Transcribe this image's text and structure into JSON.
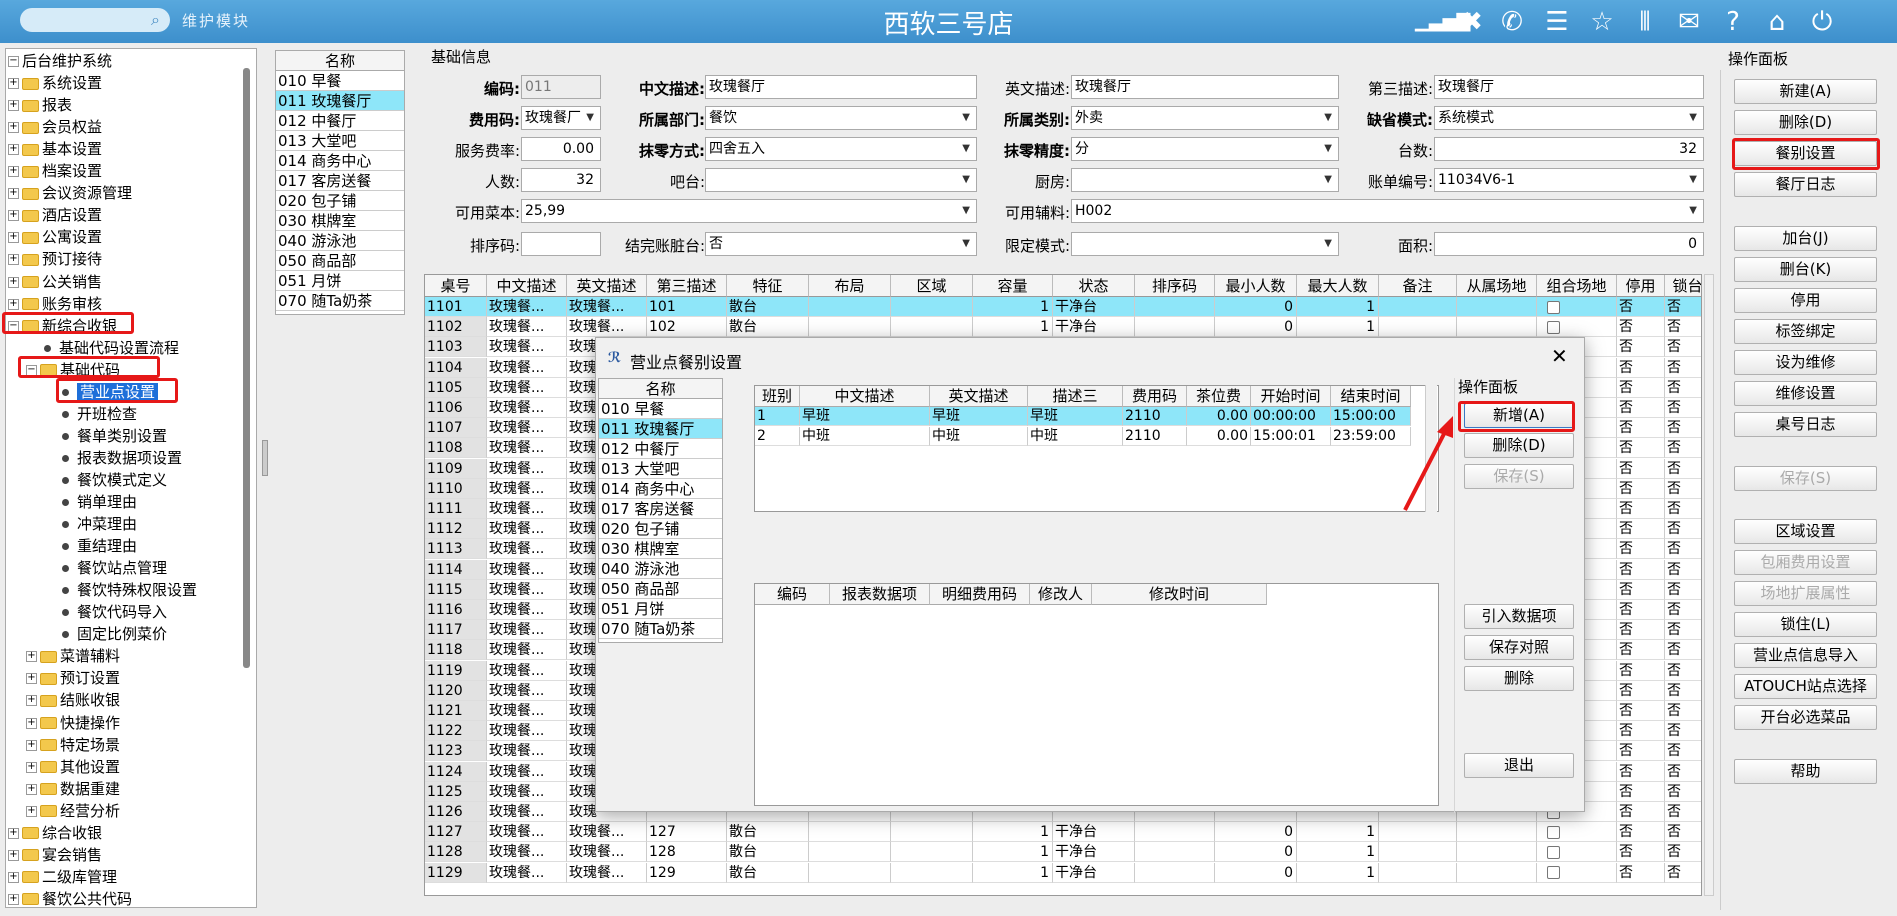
{
  "header": {
    "search_icon": "search-icon",
    "module": "维护模块",
    "title": "西软三号店",
    "icons": [
      "signal-icon",
      "tools-icon",
      "phone-icon",
      "menu-icon",
      "star-icon",
      "columns-icon",
      "mail-icon",
      "help-icon",
      "home-icon",
      "power-icon"
    ]
  },
  "tree": {
    "items": [
      {
        "label": "后台维护系统",
        "type": "root"
      },
      {
        "label": "系统设置",
        "type": "folder"
      },
      {
        "label": "报表",
        "type": "folder"
      },
      {
        "label": "会员权益",
        "type": "folder"
      },
      {
        "label": "基本设置",
        "type": "folder"
      },
      {
        "label": "档案设置",
        "type": "folder"
      },
      {
        "label": "会议资源管理",
        "type": "folder"
      },
      {
        "label": "酒店设置",
        "type": "folder"
      },
      {
        "label": "公寓设置",
        "type": "folder"
      },
      {
        "label": "预订接待",
        "type": "folder"
      },
      {
        "label": "公关销售",
        "type": "folder"
      },
      {
        "label": "账务审核",
        "type": "folder"
      },
      {
        "label": "新综合收银",
        "type": "folder-open"
      },
      {
        "label": "基础代码设置流程",
        "type": "leaf2"
      },
      {
        "label": "基础代码",
        "type": "folder-open2"
      },
      {
        "label": "营业点设置",
        "type": "leaf3-selected"
      },
      {
        "label": "开班检查",
        "type": "leaf3"
      },
      {
        "label": "餐单类别设置",
        "type": "leaf3"
      },
      {
        "label": "报表数据项设置",
        "type": "leaf3"
      },
      {
        "label": "餐饮模式定义",
        "type": "leaf3"
      },
      {
        "label": "销单理由",
        "type": "leaf3"
      },
      {
        "label": "冲菜理由",
        "type": "leaf3"
      },
      {
        "label": "重结理由",
        "type": "leaf3"
      },
      {
        "label": "餐饮站点管理",
        "type": "leaf3"
      },
      {
        "label": "餐饮特殊权限设置",
        "type": "leaf3"
      },
      {
        "label": "餐饮代码导入",
        "type": "leaf3"
      },
      {
        "label": "固定比例菜价",
        "type": "leaf3"
      },
      {
        "label": "菜谱辅料",
        "type": "folder2"
      },
      {
        "label": "预订设置",
        "type": "folder2"
      },
      {
        "label": "结账收银",
        "type": "folder2"
      },
      {
        "label": "快捷操作",
        "type": "folder2"
      },
      {
        "label": "特定场景",
        "type": "folder2"
      },
      {
        "label": "其他设置",
        "type": "folder2"
      },
      {
        "label": "数据重建",
        "type": "folder2"
      },
      {
        "label": "经营分析",
        "type": "folder2"
      },
      {
        "label": "综合收银",
        "type": "folder"
      },
      {
        "label": "宴会销售",
        "type": "folder"
      },
      {
        "label": "二级库管理",
        "type": "folder"
      },
      {
        "label": "餐饮公共代码",
        "type": "folder"
      }
    ]
  },
  "outlets": {
    "header": "名称",
    "rows": [
      "010 早餐",
      "011 玫瑰餐厅",
      "012 中餐厅",
      "013 大堂吧",
      "014 商务中心",
      "017 客房送餐",
      "020 包子铺",
      "030 棋牌室",
      "040 游泳池",
      "050 商品部",
      "051 月饼",
      "070 随Ta奶茶"
    ],
    "selected": 1
  },
  "basic": {
    "section_title": "基础信息",
    "code_label": "编码:",
    "code": "011",
    "cn_label": "中文描述:",
    "cn": "玫瑰餐厅",
    "en_label": "英文描述:",
    "en": "玫瑰餐厅",
    "third_label": "第三描述:",
    "third": "玫瑰餐厅",
    "fee_label": "费用码:",
    "fee": "玫瑰餐厂",
    "dept_label": "所属部门:",
    "dept": "餐饮",
    "cat_label": "所属类别:",
    "cat": "外卖",
    "mode_label": "缺省模式:",
    "mode": "系统模式",
    "svc_label": "服务费率:",
    "svc": "0.00",
    "round_label": "抹零方式:",
    "round": "四舍五入",
    "prec_label": "抹零精度:",
    "prec": "分",
    "tables_label": "台数:",
    "tables": "32",
    "people_label": "人数:",
    "people": "32",
    "bar_label": "吧台:",
    "bar": "",
    "kitchen_label": "厨房:",
    "kitchen": "",
    "bill_label": "账单编号:",
    "bill": "11034V6-1",
    "menu_label": "可用菜本:",
    "menu": "25,99",
    "aux_label": "可用辅料:",
    "aux": "H002",
    "sort_label": "排序码:",
    "sort": "",
    "dirty_label": "结完账脏台:",
    "dirty": "否",
    "limit_label": "限定模式:",
    "limit": "",
    "area_label": "面积:",
    "area": "0"
  },
  "grid": {
    "columns": [
      "桌号",
      "中文描述",
      "英文描述",
      "第三描述",
      "特征",
      "布局",
      "区域",
      "容量",
      "状态",
      "排序码",
      "最小人数",
      "最大人数",
      "备注",
      "从属场地",
      "组合场地",
      "停用",
      "锁台"
    ],
    "rows": [
      [
        "1101",
        "玫瑰餐...",
        "玫瑰餐...",
        "101",
        "散台",
        "",
        "",
        "1",
        "干净台",
        "",
        "0",
        "1",
        "",
        "",
        "",
        "否",
        "否"
      ],
      [
        "1102",
        "玫瑰餐...",
        "玫瑰餐...",
        "102",
        "散台",
        "",
        "",
        "1",
        "干净台",
        "",
        "0",
        "1",
        "",
        "",
        "",
        "否",
        "否"
      ],
      [
        "1103",
        "玫瑰餐...",
        "玫瑰",
        "",
        "",
        "",
        "",
        "",
        "",
        "",
        "",
        "",
        "",
        "",
        "",
        "否",
        "否"
      ],
      [
        "1104",
        "玫瑰餐...",
        "玫瑰",
        "",
        "",
        "",
        "",
        "",
        "",
        "",
        "",
        "",
        "",
        "",
        "",
        "否",
        "否"
      ],
      [
        "1105",
        "玫瑰餐...",
        "玫瑰",
        "",
        "",
        "",
        "",
        "",
        "",
        "",
        "",
        "",
        "",
        "",
        "",
        "否",
        "否"
      ],
      [
        "1106",
        "玫瑰餐...",
        "玫瑰",
        "",
        "",
        "",
        "",
        "",
        "",
        "",
        "",
        "",
        "",
        "",
        "",
        "否",
        "否"
      ],
      [
        "1107",
        "玫瑰餐...",
        "玫瑰",
        "",
        "",
        "",
        "",
        "",
        "",
        "",
        "",
        "",
        "",
        "",
        "",
        "否",
        "否"
      ],
      [
        "1108",
        "玫瑰餐...",
        "玫瑰",
        "",
        "",
        "",
        "",
        "",
        "",
        "",
        "",
        "",
        "",
        "",
        "",
        "否",
        "否"
      ],
      [
        "1109",
        "玫瑰餐...",
        "玫瑰",
        "",
        "",
        "",
        "",
        "",
        "",
        "",
        "",
        "",
        "",
        "",
        "",
        "否",
        "否"
      ],
      [
        "1110",
        "玫瑰餐...",
        "玫瑰",
        "",
        "",
        "",
        "",
        "",
        "",
        "",
        "",
        "",
        "",
        "",
        "",
        "否",
        "否"
      ],
      [
        "1111",
        "玫瑰餐...",
        "玫瑰",
        "",
        "",
        "",
        "",
        "",
        "",
        "",
        "",
        "",
        "",
        "",
        "",
        "否",
        "否"
      ],
      [
        "1112",
        "玫瑰餐...",
        "玫瑰",
        "",
        "",
        "",
        "",
        "",
        "",
        "",
        "",
        "",
        "",
        "",
        "",
        "否",
        "否"
      ],
      [
        "1113",
        "玫瑰餐...",
        "玫瑰",
        "",
        "",
        "",
        "",
        "",
        "",
        "",
        "",
        "",
        "",
        "",
        "",
        "否",
        "否"
      ],
      [
        "1114",
        "玫瑰餐...",
        "玫瑰",
        "",
        "",
        "",
        "",
        "",
        "",
        "",
        "",
        "",
        "",
        "",
        "",
        "否",
        "否"
      ],
      [
        "1115",
        "玫瑰餐...",
        "玫瑰",
        "",
        "",
        "",
        "",
        "",
        "",
        "",
        "",
        "",
        "",
        "",
        "",
        "否",
        "否"
      ],
      [
        "1116",
        "玫瑰餐...",
        "玫瑰",
        "",
        "",
        "",
        "",
        "",
        "",
        "",
        "",
        "",
        "",
        "",
        "",
        "否",
        "否"
      ],
      [
        "1117",
        "玫瑰餐...",
        "玫瑰",
        "",
        "",
        "",
        "",
        "",
        "",
        "",
        "",
        "",
        "",
        "",
        "",
        "否",
        "否"
      ],
      [
        "1118",
        "玫瑰餐...",
        "玫瑰",
        "",
        "",
        "",
        "",
        "",
        "",
        "",
        "",
        "",
        "",
        "",
        "",
        "否",
        "否"
      ],
      [
        "1119",
        "玫瑰餐...",
        "玫瑰",
        "",
        "",
        "",
        "",
        "",
        "",
        "",
        "",
        "",
        "",
        "",
        "",
        "否",
        "否"
      ],
      [
        "1120",
        "玫瑰餐...",
        "玫瑰",
        "",
        "",
        "",
        "",
        "",
        "",
        "",
        "",
        "",
        "",
        "",
        "",
        "否",
        "否"
      ],
      [
        "1121",
        "玫瑰餐...",
        "玫瑰",
        "",
        "",
        "",
        "",
        "",
        "",
        "",
        "",
        "",
        "",
        "",
        "",
        "否",
        "否"
      ],
      [
        "1122",
        "玫瑰餐...",
        "玫瑰",
        "",
        "",
        "",
        "",
        "",
        "",
        "",
        "",
        "",
        "",
        "",
        "",
        "否",
        "否"
      ],
      [
        "1123",
        "玫瑰餐...",
        "玫瑰",
        "",
        "",
        "",
        "",
        "",
        "",
        "",
        "",
        "",
        "",
        "",
        "",
        "否",
        "否"
      ],
      [
        "1124",
        "玫瑰餐...",
        "玫瑰",
        "",
        "",
        "",
        "",
        "",
        "",
        "",
        "",
        "",
        "",
        "",
        "",
        "否",
        "否"
      ],
      [
        "1125",
        "玫瑰餐...",
        "玫瑰",
        "",
        "",
        "",
        "",
        "",
        "",
        "",
        "",
        "",
        "",
        "",
        "",
        "否",
        "否"
      ],
      [
        "1126",
        "玫瑰餐...",
        "玫瑰",
        "",
        "",
        "",
        "",
        "",
        "",
        "",
        "",
        "",
        "",
        "",
        "",
        "否",
        "否"
      ],
      [
        "1127",
        "玫瑰餐...",
        "玫瑰餐...",
        "127",
        "散台",
        "",
        "",
        "1",
        "干净台",
        "",
        "0",
        "1",
        "",
        "",
        "",
        "否",
        "否"
      ],
      [
        "1128",
        "玫瑰餐...",
        "玫瑰餐...",
        "128",
        "散台",
        "",
        "",
        "1",
        "干净台",
        "",
        "0",
        "1",
        "",
        "",
        "",
        "否",
        "否"
      ],
      [
        "1129",
        "玫瑰餐...",
        "玫瑰餐...",
        "129",
        "散台",
        "",
        "",
        "1",
        "干净台",
        "",
        "0",
        "1",
        "",
        "",
        "",
        "否",
        "否"
      ]
    ]
  },
  "right_panel": {
    "title": "操作面板",
    "buttons": [
      "新建(A)",
      "删除(D)",
      "餐别设置",
      "餐厅日志",
      "加台(J)",
      "删台(K)",
      "停用",
      "标签绑定",
      "设为维修",
      "维修设置",
      "桌号日志",
      "保存(S)",
      "区域设置",
      "包厢费用设置",
      "场地扩展属性",
      "锁住(L)",
      "营业点信息导入",
      "ATOUCH站点选择",
      "开台必选菜品",
      "帮助"
    ]
  },
  "dialog": {
    "title": "营业点餐别设置",
    "logo": "xr-logo-icon",
    "close": "close-icon",
    "list_header": "名称",
    "shift_columns": [
      "班别",
      "中文描述",
      "英文描述",
      "描述三",
      "费用码",
      "茶位费",
      "开始时间",
      "结束时间"
    ],
    "shifts": [
      [
        "1",
        "早班",
        "早班",
        "早班",
        "2110",
        "0.00",
        "00:00:00",
        "15:00:00"
      ],
      [
        "2",
        "中班",
        "中班",
        "中班",
        "2110",
        "0.00",
        "15:00:01",
        "23:59:00"
      ]
    ],
    "report_columns": [
      "编码",
      "报表数据项",
      "明细费用码",
      "修改人",
      "修改时间"
    ],
    "panel_title": "操作面板",
    "buttons": {
      "add": "新增(A)",
      "del": "删除(D)",
      "save": "保存(S)",
      "import": "引入数据项",
      "save_map": "保存对照",
      "del2": "删除",
      "exit": "退出"
    }
  },
  "colors": {
    "header": "#4a9ad4",
    "selected_row": "#8ee6f9",
    "highlight": "#e61818"
  }
}
